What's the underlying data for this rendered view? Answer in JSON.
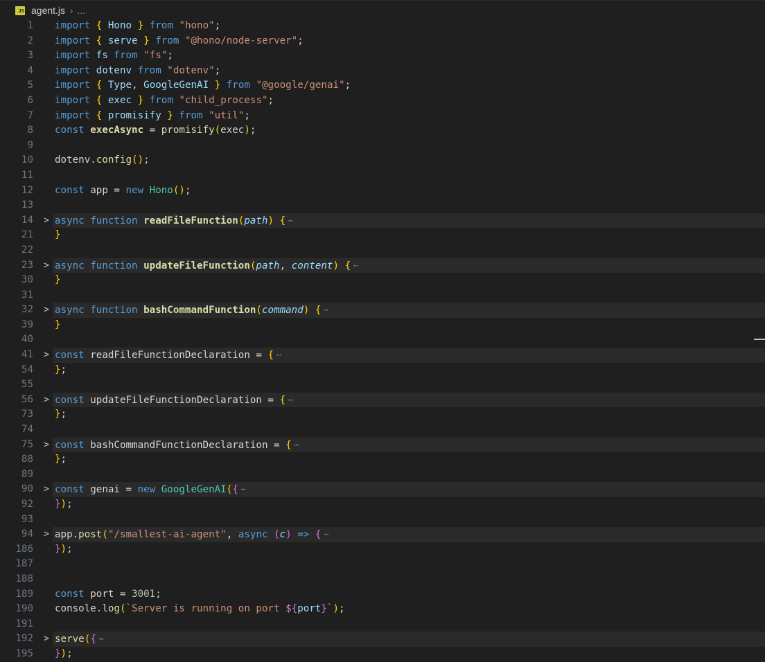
{
  "breadcrumb": {
    "icon_label": "JS",
    "file": "agent.js",
    "more": "..."
  },
  "lines": [
    {
      "n": "1",
      "tokens": [
        [
          "kw",
          "import "
        ],
        [
          "b1",
          "{ "
        ],
        [
          "var",
          "Hono"
        ],
        [
          "b1",
          " }"
        ],
        [
          "kw",
          " from "
        ],
        [
          "str",
          "\"hono\""
        ],
        [
          "plain",
          ";"
        ]
      ]
    },
    {
      "n": "2",
      "tokens": [
        [
          "kw",
          "import "
        ],
        [
          "b1",
          "{ "
        ],
        [
          "var",
          "serve"
        ],
        [
          "b1",
          " }"
        ],
        [
          "kw",
          " from "
        ],
        [
          "str",
          "\"@hono/node-server\""
        ],
        [
          "plain",
          ";"
        ]
      ]
    },
    {
      "n": "3",
      "tokens": [
        [
          "kw",
          "import "
        ],
        [
          "var",
          "fs"
        ],
        [
          "kw",
          " from "
        ],
        [
          "str",
          "\"fs\""
        ],
        [
          "plain",
          ";"
        ]
      ]
    },
    {
      "n": "4",
      "tokens": [
        [
          "kw",
          "import "
        ],
        [
          "var",
          "dotenv"
        ],
        [
          "kw",
          " from "
        ],
        [
          "str",
          "\"dotenv\""
        ],
        [
          "plain",
          ";"
        ]
      ]
    },
    {
      "n": "5",
      "tokens": [
        [
          "kw",
          "import "
        ],
        [
          "b1",
          "{ "
        ],
        [
          "var",
          "Type"
        ],
        [
          "plain",
          ", "
        ],
        [
          "var",
          "GoogleGenAI"
        ],
        [
          "b1",
          " }"
        ],
        [
          "kw",
          " from "
        ],
        [
          "str",
          "\"@google/genai\""
        ],
        [
          "plain",
          ";"
        ]
      ]
    },
    {
      "n": "6",
      "tokens": [
        [
          "kw",
          "import "
        ],
        [
          "b1",
          "{ "
        ],
        [
          "var",
          "exec"
        ],
        [
          "b1",
          " }"
        ],
        [
          "kw",
          " from "
        ],
        [
          "str",
          "\"child_process\""
        ],
        [
          "plain",
          ";"
        ]
      ]
    },
    {
      "n": "7",
      "tokens": [
        [
          "kw",
          "import "
        ],
        [
          "b1",
          "{ "
        ],
        [
          "var",
          "promisify"
        ],
        [
          "b1",
          " }"
        ],
        [
          "kw",
          " from "
        ],
        [
          "str",
          "\"util\""
        ],
        [
          "plain",
          ";"
        ]
      ]
    },
    {
      "n": "8",
      "tokens": [
        [
          "kw",
          "const "
        ],
        [
          "boldfn",
          "execAsync"
        ],
        [
          "plain",
          " = "
        ],
        [
          "fn",
          "promisify"
        ],
        [
          "b1",
          "("
        ],
        [
          "plain",
          "exec"
        ],
        [
          "b1",
          ")"
        ],
        [
          "plain",
          ";"
        ]
      ]
    },
    {
      "n": "9",
      "tokens": []
    },
    {
      "n": "10",
      "tokens": [
        [
          "plain",
          "dotenv."
        ],
        [
          "fn",
          "config"
        ],
        [
          "b1",
          "()"
        ],
        [
          "plain",
          ";"
        ]
      ]
    },
    {
      "n": "11",
      "tokens": []
    },
    {
      "n": "12",
      "tokens": [
        [
          "kw",
          "const "
        ],
        [
          "plain",
          "app = "
        ],
        [
          "kw",
          "new "
        ],
        [
          "cls",
          "Hono"
        ],
        [
          "b1",
          "()"
        ],
        [
          "plain",
          ";"
        ]
      ]
    },
    {
      "n": "13",
      "tokens": []
    },
    {
      "n": "14",
      "folded": true,
      "tokens": [
        [
          "kw",
          "async function "
        ],
        [
          "boldfn",
          "readFileFunction"
        ],
        [
          "b1",
          "("
        ],
        [
          "prm",
          "path"
        ],
        [
          "b1",
          ")"
        ],
        [
          "plain",
          " "
        ],
        [
          "b1",
          "{"
        ]
      ]
    },
    {
      "n": "21",
      "tokens": [
        [
          "b1",
          "}"
        ]
      ]
    },
    {
      "n": "22",
      "tokens": []
    },
    {
      "n": "23",
      "folded": true,
      "tokens": [
        [
          "kw",
          "async function "
        ],
        [
          "boldfn",
          "updateFileFunction"
        ],
        [
          "b1",
          "("
        ],
        [
          "prm",
          "path"
        ],
        [
          "plain",
          ", "
        ],
        [
          "prm",
          "content"
        ],
        [
          "b1",
          ")"
        ],
        [
          "plain",
          " "
        ],
        [
          "b1",
          "{"
        ]
      ]
    },
    {
      "n": "30",
      "tokens": [
        [
          "b1",
          "}"
        ]
      ]
    },
    {
      "n": "31",
      "tokens": []
    },
    {
      "n": "32",
      "folded": true,
      "tokens": [
        [
          "kw",
          "async function "
        ],
        [
          "boldfn",
          "bashCommandFunction"
        ],
        [
          "b1",
          "("
        ],
        [
          "prm",
          "command"
        ],
        [
          "b1",
          ")"
        ],
        [
          "plain",
          " "
        ],
        [
          "b1",
          "{"
        ]
      ]
    },
    {
      "n": "39",
      "tokens": [
        [
          "b1",
          "}"
        ]
      ]
    },
    {
      "n": "40",
      "tokens": []
    },
    {
      "n": "41",
      "folded": true,
      "tokens": [
        [
          "kw",
          "const "
        ],
        [
          "plain",
          "readFileFunctionDeclaration = "
        ],
        [
          "b1",
          "{"
        ]
      ]
    },
    {
      "n": "54",
      "tokens": [
        [
          "b1",
          "}"
        ],
        [
          "plain",
          ";"
        ]
      ]
    },
    {
      "n": "55",
      "tokens": []
    },
    {
      "n": "56",
      "folded": true,
      "tokens": [
        [
          "kw",
          "const "
        ],
        [
          "plain",
          "updateFileFunctionDeclaration = "
        ],
        [
          "b1",
          "{"
        ]
      ]
    },
    {
      "n": "73",
      "tokens": [
        [
          "b1",
          "}"
        ],
        [
          "plain",
          ";"
        ]
      ]
    },
    {
      "n": "74",
      "tokens": []
    },
    {
      "n": "75",
      "folded": true,
      "tokens": [
        [
          "kw",
          "const "
        ],
        [
          "plain",
          "bashCommandFunctionDeclaration = "
        ],
        [
          "b1",
          "{"
        ]
      ]
    },
    {
      "n": "88",
      "tokens": [
        [
          "b1",
          "}"
        ],
        [
          "plain",
          ";"
        ]
      ]
    },
    {
      "n": "89",
      "tokens": []
    },
    {
      "n": "90",
      "folded": true,
      "tokens": [
        [
          "kw",
          "const "
        ],
        [
          "plain",
          "genai = "
        ],
        [
          "kw",
          "new "
        ],
        [
          "cls",
          "GoogleGenAI"
        ],
        [
          "b1",
          "("
        ],
        [
          "b2",
          "{"
        ]
      ]
    },
    {
      "n": "92",
      "tokens": [
        [
          "b2",
          "}"
        ],
        [
          "b1",
          ")"
        ],
        [
          "plain",
          ";"
        ]
      ]
    },
    {
      "n": "93",
      "tokens": []
    },
    {
      "n": "94",
      "folded": true,
      "tokens": [
        [
          "plain",
          "app."
        ],
        [
          "fn",
          "post"
        ],
        [
          "b1",
          "("
        ],
        [
          "str",
          "\"/smallest-ai-agent\""
        ],
        [
          "plain",
          ", "
        ],
        [
          "kw",
          "async "
        ],
        [
          "b2",
          "("
        ],
        [
          "prm",
          "c"
        ],
        [
          "b2",
          ")"
        ],
        [
          "plain",
          " "
        ],
        [
          "kw",
          "=>"
        ],
        [
          "plain",
          " "
        ],
        [
          "b2",
          "{"
        ]
      ]
    },
    {
      "n": "186",
      "tokens": [
        [
          "b2",
          "}"
        ],
        [
          "b1",
          ")"
        ],
        [
          "plain",
          ";"
        ]
      ]
    },
    {
      "n": "187",
      "tokens": []
    },
    {
      "n": "188",
      "tokens": []
    },
    {
      "n": "189",
      "tokens": [
        [
          "kw",
          "const "
        ],
        [
          "plain",
          "port = "
        ],
        [
          "num",
          "3001"
        ],
        [
          "plain",
          ";"
        ]
      ]
    },
    {
      "n": "190",
      "tokens": [
        [
          "plain",
          "console."
        ],
        [
          "fn",
          "log"
        ],
        [
          "b1",
          "("
        ],
        [
          "str",
          "`Server is running on port "
        ],
        [
          "ctl",
          "${"
        ],
        [
          "var",
          "port"
        ],
        [
          "ctl",
          "}"
        ],
        [
          "str",
          "`"
        ],
        [
          "b1",
          ")"
        ],
        [
          "plain",
          ";"
        ]
      ]
    },
    {
      "n": "191",
      "tokens": []
    },
    {
      "n": "192",
      "folded": true,
      "tokens": [
        [
          "fn",
          "serve"
        ],
        [
          "b1",
          "("
        ],
        [
          "b2",
          "{"
        ]
      ]
    },
    {
      "n": "195",
      "tokens": [
        [
          "b2",
          "}"
        ],
        [
          "b1",
          ")"
        ],
        [
          "plain",
          ";"
        ]
      ]
    }
  ],
  "fold_glyph": ">",
  "ellipsis_glyph": "⋯"
}
